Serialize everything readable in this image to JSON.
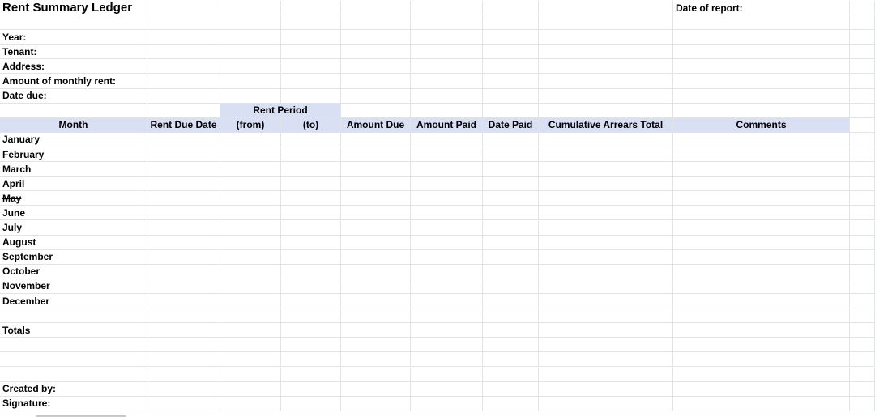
{
  "title": "Rent Summary Ledger",
  "report_date_label": "Date of report:",
  "info_labels": [
    "Year:",
    "Tenant:",
    "Address:",
    "Amount of monthly rent:",
    "Date due:"
  ],
  "rent_period_label": "Rent Period",
  "columns": [
    "Month",
    "Rent Due Date",
    "(from)",
    "(to)",
    "Amount Due",
    "Amount Paid",
    "Date Paid",
    "Cumulative Arrears Total",
    "Comments"
  ],
  "months": [
    "January",
    "February",
    "March",
    "April",
    "May",
    "June",
    "July",
    "August",
    "September",
    "October",
    "November",
    "December"
  ],
  "totals_label": "Totals",
  "created_by_label": "Created by:",
  "signature_label": "Signature:",
  "colors": {
    "header_fill": "#dae0f3",
    "gridline": "#e2e3e3"
  }
}
